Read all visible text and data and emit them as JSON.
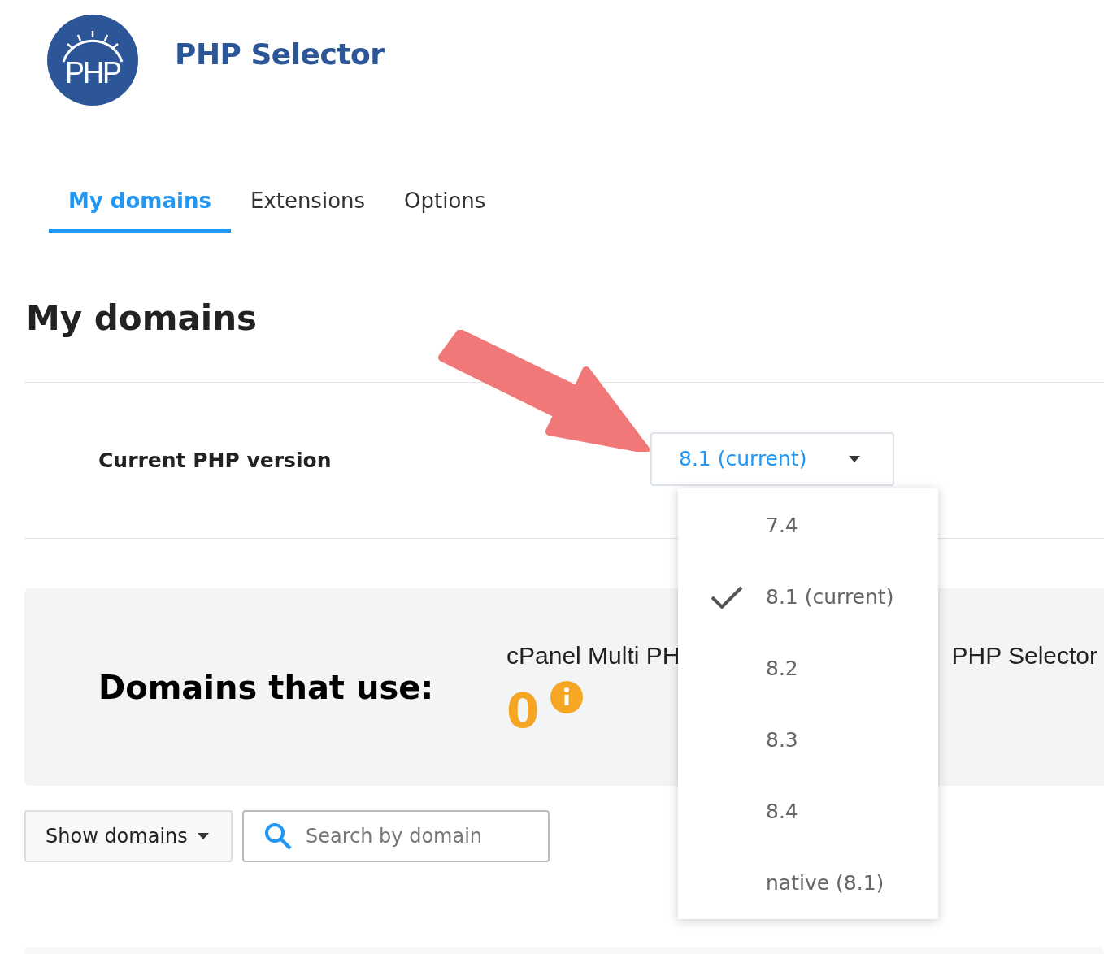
{
  "header": {
    "logo_text": "PHP",
    "title": "PHP Selector"
  },
  "tabs": [
    {
      "label": "My domains",
      "selected": true
    },
    {
      "label": "Extensions",
      "selected": false
    },
    {
      "label": "Options",
      "selected": false
    }
  ],
  "heading": "My domains",
  "version_row": {
    "label": "Current PHP version",
    "value": "8.1 (current)"
  },
  "version_menu": {
    "items": [
      {
        "label": "7.4",
        "selected": false
      },
      {
        "label": "8.1 (current)",
        "selected": true
      },
      {
        "label": "8.2",
        "selected": false
      },
      {
        "label": "8.3",
        "selected": false
      },
      {
        "label": "8.4",
        "selected": false
      },
      {
        "label": "native (8.1)",
        "selected": false
      }
    ]
  },
  "summary": {
    "title": "Domains that use:",
    "stats": [
      {
        "label": "cPanel Multi PH",
        "count": "0"
      },
      {
        "label": "PHP Selector"
      }
    ]
  },
  "toolbar": {
    "filter_button": "Show domains",
    "search": {
      "placeholder": "Search by domain"
    }
  }
}
